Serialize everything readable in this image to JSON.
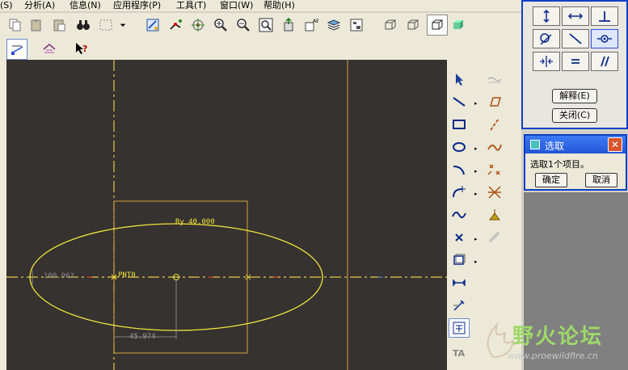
{
  "menu": {
    "items": [
      "(S)",
      "分析(A)",
      "信息(N)",
      "应用程序(P)",
      "工具(T)",
      "窗口(W)",
      "帮助(H)"
    ]
  },
  "toolbar": {
    "row1_icons": [
      "copy-icon",
      "paste-icon",
      "paste-special-icon",
      "binoculars-icon",
      "select-box-icon",
      "dropdown-icon",
      "regenerate-icon",
      "sketch-relations-icon",
      "spin-center-icon",
      "zoom-in-icon",
      "zoom-out-icon",
      "refit-icon",
      "reorient-icon",
      "named-view-icon",
      "layers-icon",
      "model-tree-icon",
      "wireframe-icon",
      "hidden-line-icon",
      "no-hidden-icon",
      "shading-icon"
    ],
    "row2_icons": [
      "sketch-view-icon",
      "display-toggle-icon",
      "help-context-icon"
    ]
  },
  "sketch": {
    "dimension_ry": "Ry 40.000",
    "dimension_left": "100.963",
    "point_label": "PNT0",
    "dimension_bottom": "45.974"
  },
  "palette": {
    "icons": [
      "select-arrow-icon",
      "line-icon",
      "rectangle-icon",
      "ellipse-icon",
      "arc-icon",
      "fillet-icon",
      "spline-icon",
      "point-icon",
      "use-edge-icon",
      "dimension-icon",
      "modify-icon",
      "constraint-icon",
      "text-icon",
      "centerline-icon",
      "parallelogram-icon",
      "dashed-line-icon",
      "curve-icon",
      "trim-icon",
      "divide-icon",
      "palette-icon",
      "mirror-icon"
    ]
  },
  "constraints": {
    "buttons": [
      "vertical-constraint",
      "horizontal-constraint",
      "perpendicular-constraint",
      "tangent-constraint",
      "midpoint-constraint",
      "coincident-constraint",
      "symmetric-constraint",
      "equal-constraint",
      "parallel-constraint"
    ],
    "explain_label": "解释(E)",
    "close_label": "关闭(C)"
  },
  "select_dialog": {
    "title": "选取",
    "message": "选取1个项目。",
    "ok_label": "确定",
    "cancel_label": "取消"
  },
  "watermark": {
    "title": "野火论坛",
    "url": "www.proewildfire.cn"
  },
  "colors": {
    "canvas_bg": "#353230",
    "sketch_yellow": "#f0e23a",
    "sketch_orange": "#d8a23c",
    "dim_grey": "#9a9a9a",
    "window_blue": "#0b3fc4"
  }
}
